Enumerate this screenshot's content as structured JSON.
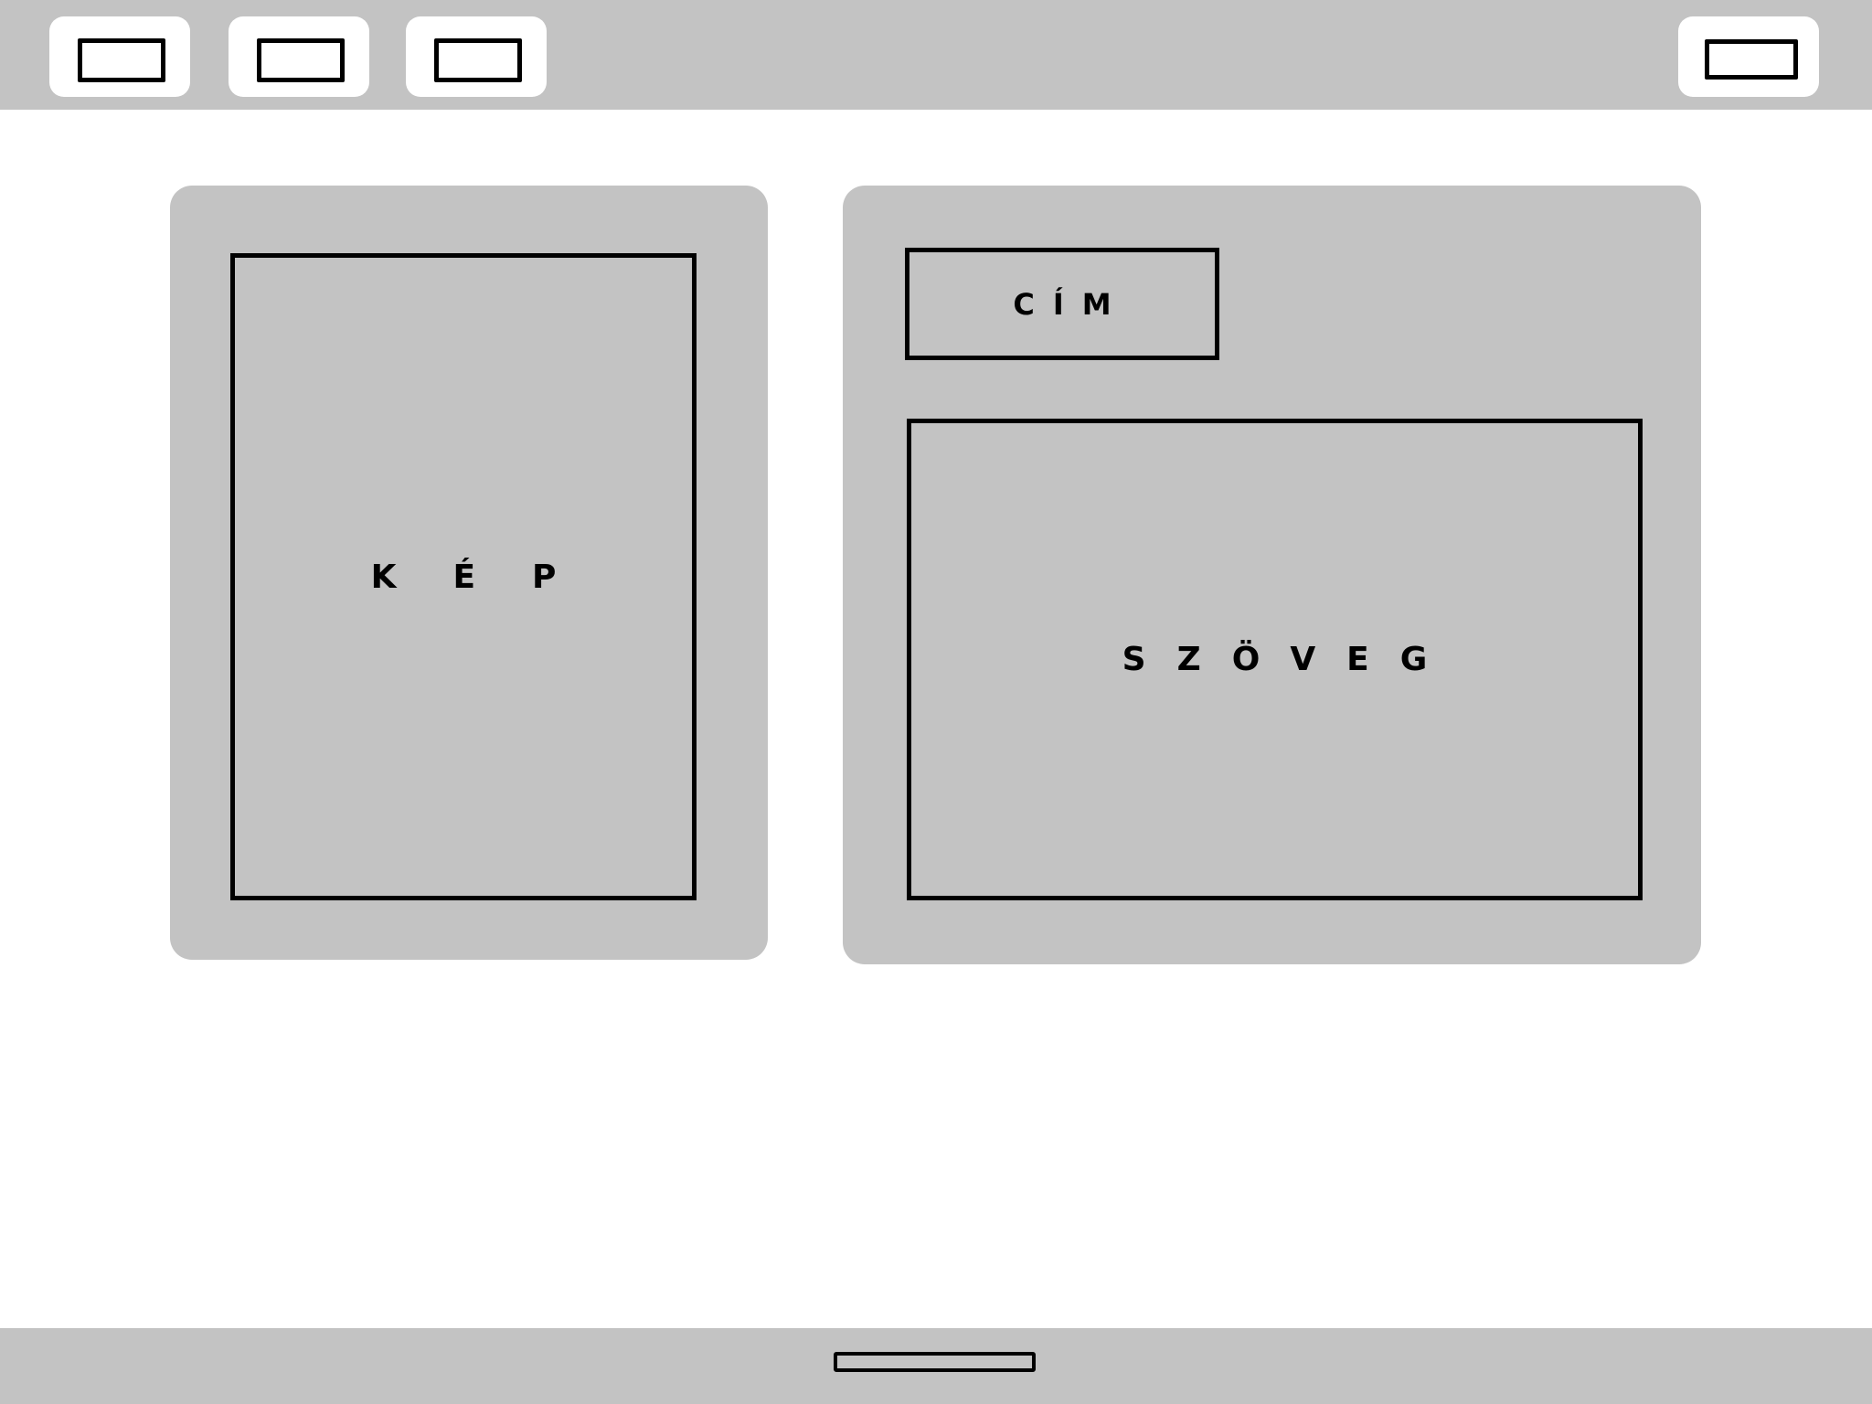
{
  "colors": {
    "bar": "#c3c3c3",
    "card": "#c3c3c3",
    "background": "#ffffff",
    "stroke": "#000000"
  },
  "header": {
    "nav_buttons": [
      {
        "icon": "rectangle-outline-icon"
      },
      {
        "icon": "rectangle-outline-icon"
      },
      {
        "icon": "rectangle-outline-icon"
      }
    ],
    "right_button": {
      "icon": "rectangle-outline-icon"
    }
  },
  "main": {
    "image_card": {
      "label": "KÉP"
    },
    "content_card": {
      "title_label": "CÍM",
      "text_label": "SZÖVEG"
    }
  },
  "footer": {
    "slot": {
      "icon": "rectangle-outline-icon"
    }
  }
}
